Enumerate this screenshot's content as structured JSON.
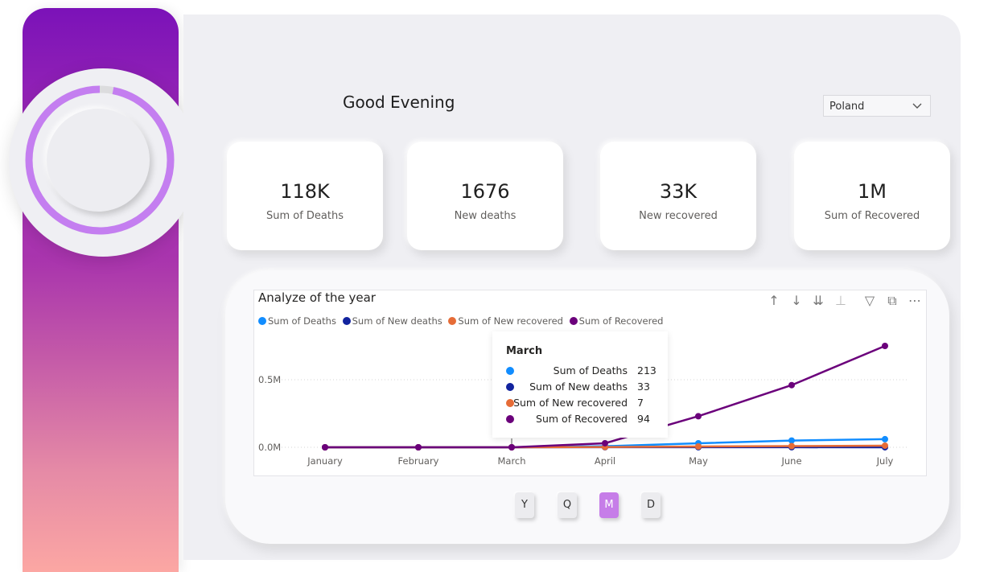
{
  "header": {
    "greeting": "Good Evening"
  },
  "filter": {
    "selected": "Poland"
  },
  "kpis": [
    {
      "value": "118K",
      "label": "Sum of Deaths"
    },
    {
      "value": "1676",
      "label": "New deaths"
    },
    {
      "value": "33K",
      "label": "New recovered"
    },
    {
      "value": "1M",
      "label": "Sum of Recovered"
    }
  ],
  "visual": {
    "toolbar_icons": [
      "arrow-up-icon",
      "arrow-down-icon",
      "double-arrow-down-icon",
      "expand-hierarchy-icon",
      "filter-icon",
      "focus-mode-icon",
      "more-options-icon"
    ]
  },
  "chart_data": {
    "type": "line",
    "title": "Analyze of the year",
    "categories": [
      "January",
      "February",
      "March",
      "April",
      "May",
      "June",
      "July"
    ],
    "y_ticks": [
      "0.0M",
      "0.5M"
    ],
    "ylim": [
      0,
      1000000
    ],
    "grid": true,
    "legend_position": "top-left",
    "series": [
      {
        "name": "Sum of Deaths",
        "color": "#118DFF",
        "values": [
          0,
          0,
          213,
          8000,
          30000,
          50000,
          60000
        ]
      },
      {
        "name": "Sum of New deaths",
        "color": "#12239E",
        "values": [
          0,
          0,
          33,
          600,
          800,
          400,
          300
        ]
      },
      {
        "name": "Sum of New recovered",
        "color": "#E66C37",
        "values": [
          0,
          0,
          7,
          2000,
          6000,
          9000,
          12000
        ]
      },
      {
        "name": "Sum of Recovered",
        "color": "#6B007B",
        "values": [
          0,
          0,
          94,
          30000,
          230000,
          460000,
          750000
        ]
      }
    ]
  },
  "tooltip": {
    "title": "March",
    "rows": [
      {
        "name": "Sum of Deaths",
        "value": "213",
        "color": "#118DFF"
      },
      {
        "name": "Sum of New deaths",
        "value": "33",
        "color": "#12239E"
      },
      {
        "name": "Sum of New recovered",
        "value": "7",
        "color": "#E66C37"
      },
      {
        "name": "Sum of Recovered",
        "value": "94",
        "color": "#6B007B"
      }
    ]
  },
  "granularity": {
    "buttons": [
      "Y",
      "Q",
      "M",
      "D"
    ],
    "active": "M"
  },
  "progress": {
    "fraction": 0.97,
    "color": "#c47ef0"
  }
}
